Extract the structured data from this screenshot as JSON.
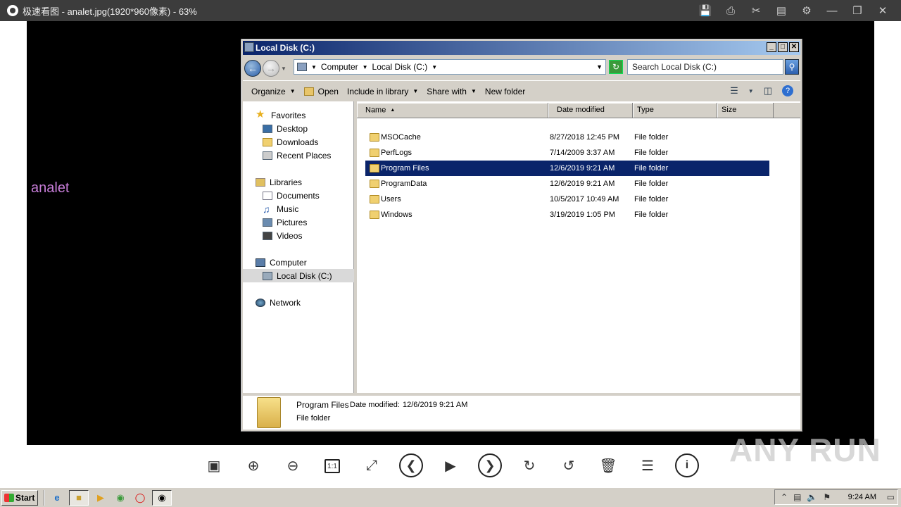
{
  "viewer": {
    "title": "极速看图 - analet.jpg(1920*960像素) - 63%",
    "tools": [
      "save-icon",
      "print-icon",
      "cut-icon",
      "comment-icon",
      "settings-icon",
      "minimize-icon",
      "restore-icon",
      "close-icon"
    ],
    "bottom_tools": [
      "image-icon",
      "zoom-in-icon",
      "zoom-out-icon",
      "actual-size-icon",
      "fit-icon",
      "prev-icon",
      "slideshow-icon",
      "next-icon",
      "rotate-right-icon",
      "rotate-left-icon",
      "delete-icon",
      "menu-icon",
      "info-icon"
    ],
    "actual_size_label": "1:1"
  },
  "image_text": "analet",
  "explorer": {
    "title": "Local Disk (C:)",
    "breadcrumb": [
      "Computer",
      "Local Disk (C:)"
    ],
    "search_placeholder": "Search Local Disk (C:)",
    "commands": {
      "organize": "Organize",
      "open": "Open",
      "include": "Include in library",
      "share": "Share with",
      "newfolder": "New folder"
    },
    "nav": {
      "favorites": "Favorites",
      "desktop": "Desktop",
      "downloads": "Downloads",
      "recent": "Recent Places",
      "libraries": "Libraries",
      "documents": "Documents",
      "music": "Music",
      "pictures": "Pictures",
      "videos": "Videos",
      "computer": "Computer",
      "localdisk": "Local Disk (C:)",
      "network": "Network"
    },
    "columns": {
      "name": "Name",
      "date": "Date modified",
      "type": "Type",
      "size": "Size"
    },
    "files": [
      {
        "name": "MSOCache",
        "date": "8/27/2018 12:45 PM",
        "type": "File folder"
      },
      {
        "name": "PerfLogs",
        "date": "7/14/2009 3:37 AM",
        "type": "File folder"
      },
      {
        "name": "Program Files",
        "date": "12/6/2019 9:21 AM",
        "type": "File folder"
      },
      {
        "name": "ProgramData",
        "date": "12/6/2019 9:21 AM",
        "type": "File folder"
      },
      {
        "name": "Users",
        "date": "10/5/2017 10:49 AM",
        "type": "File folder"
      },
      {
        "name": "Windows",
        "date": "3/19/2019 1:05 PM",
        "type": "File folder"
      }
    ],
    "selected_index": 2,
    "details": {
      "name": "Program Files",
      "modified_label": "Date modified:",
      "modified_value": "12/6/2019 9:21 AM",
      "type": "File folder"
    }
  },
  "watermark": "ANY RUN",
  "taskbar": {
    "start": "Start",
    "clock": "9:24 AM"
  }
}
